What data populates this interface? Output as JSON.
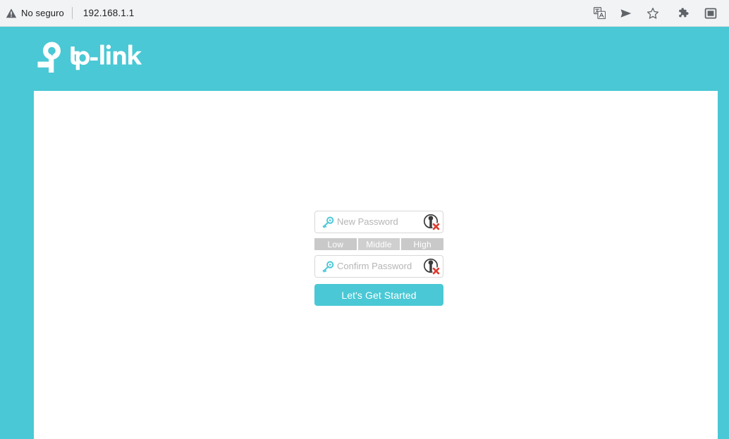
{
  "browser": {
    "security_label": "No seguro",
    "url": "192.168.1.1",
    "security_icon": "warning-triangle-icon",
    "toolbar_icons": [
      {
        "name": "translate-icon",
        "label": "Traducir"
      },
      {
        "name": "send-to-devices-icon",
        "label": "Enviar"
      },
      {
        "name": "bookmark-star-icon",
        "label": "Marcador"
      },
      {
        "name": "extensions-puzzle-icon",
        "label": "Extensiones"
      },
      {
        "name": "sidepanel-icon",
        "label": "Panel lateral"
      }
    ]
  },
  "brand": {
    "name": "tp-link",
    "logo_alt": "TP-Link"
  },
  "theme": {
    "accent": "#4ac8d5",
    "accent_dark": "#3fbecb",
    "page_bg": "#ffffff",
    "field_border": "#d8d8d8",
    "placeholder": "#b5b5b5",
    "strength_bar": "#c9c9c9",
    "broken_x": "#e03b30",
    "key_icon": "#4ac8d5"
  },
  "form": {
    "new_password": {
      "placeholder": "New Password",
      "value": "",
      "icon": "key-icon",
      "reveal_icon": "broken-image-icon"
    },
    "confirm_password": {
      "placeholder": "Confirm Password",
      "value": "",
      "icon": "key-icon",
      "reveal_icon": "broken-image-icon"
    },
    "strength_levels": [
      {
        "label": "Low"
      },
      {
        "label": "Middle"
      },
      {
        "label": "High"
      }
    ],
    "submit_label": "Let's Get Started"
  }
}
